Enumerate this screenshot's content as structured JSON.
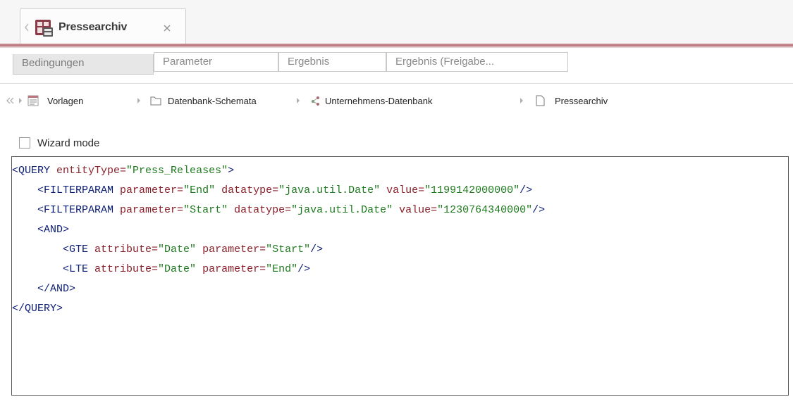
{
  "document_tab": {
    "title": "Pressearchiv",
    "close_icon": "close-icon",
    "app_icon": "database-schema-icon"
  },
  "subtabs": [
    {
      "label": "Bedingungen",
      "active": true
    },
    {
      "label": "Parameter",
      "active": false
    },
    {
      "label": "Ergebnis",
      "active": false
    },
    {
      "label": "Ergebnis (Freigabe...",
      "active": false
    }
  ],
  "breadcrumb": {
    "back_icon": "double-chevron-left-icon",
    "items": [
      {
        "label": "Vorlagen",
        "icon": "template-list-icon"
      },
      {
        "label": "Datenbank-Schemata",
        "icon": "folder-icon"
      },
      {
        "label": "Unternehmens-Datenbank",
        "icon": "database-connection-icon"
      },
      {
        "label": "Pressearchiv",
        "icon": "document-icon"
      }
    ]
  },
  "wizard": {
    "label": "Wizard mode",
    "checked": false
  },
  "editor": {
    "lines": [
      {
        "indent": "",
        "parts": [
          {
            "t": "<QUERY ",
            "c": "tag"
          },
          {
            "t": "entityType=",
            "c": "att"
          },
          {
            "t": "\"Press_Releases\"",
            "c": "str"
          },
          {
            "t": ">",
            "c": "tag"
          }
        ]
      },
      {
        "indent": "    ",
        "parts": [
          {
            "t": "<FILTERPARAM ",
            "c": "tag"
          },
          {
            "t": "parameter=",
            "c": "att"
          },
          {
            "t": "\"End\" ",
            "c": "str"
          },
          {
            "t": "datatype=",
            "c": "att"
          },
          {
            "t": "\"java.util.Date\" ",
            "c": "str"
          },
          {
            "t": "value=",
            "c": "att"
          },
          {
            "t": "\"1199142000000\"",
            "c": "str"
          },
          {
            "t": "/>",
            "c": "tag"
          }
        ]
      },
      {
        "indent": "    ",
        "parts": [
          {
            "t": "<FILTERPARAM ",
            "c": "tag"
          },
          {
            "t": "parameter=",
            "c": "att"
          },
          {
            "t": "\"Start\" ",
            "c": "str"
          },
          {
            "t": "datatype=",
            "c": "att"
          },
          {
            "t": "\"java.util.Date\" ",
            "c": "str"
          },
          {
            "t": "value=",
            "c": "att"
          },
          {
            "t": "\"1230764340000\"",
            "c": "str"
          },
          {
            "t": "/>",
            "c": "tag"
          }
        ]
      },
      {
        "indent": "    ",
        "parts": [
          {
            "t": "<AND>",
            "c": "tag"
          }
        ]
      },
      {
        "indent": "        ",
        "parts": [
          {
            "t": "<GTE ",
            "c": "tag"
          },
          {
            "t": "attribute=",
            "c": "att"
          },
          {
            "t": "\"Date\" ",
            "c": "str"
          },
          {
            "t": "parameter=",
            "c": "att"
          },
          {
            "t": "\"Start\"",
            "c": "str"
          },
          {
            "t": "/>",
            "c": "tag"
          }
        ]
      },
      {
        "indent": "        ",
        "parts": [
          {
            "t": "<LTE ",
            "c": "tag"
          },
          {
            "t": "attribute=",
            "c": "att"
          },
          {
            "t": "\"Date\" ",
            "c": "str"
          },
          {
            "t": "parameter=",
            "c": "att"
          },
          {
            "t": "\"End\"",
            "c": "str"
          },
          {
            "t": "/>",
            "c": "tag"
          }
        ]
      },
      {
        "indent": "    ",
        "parts": [
          {
            "t": "</AND>",
            "c": "tag"
          }
        ]
      },
      {
        "indent": "",
        "parts": [
          {
            "t": "</QUERY>",
            "c": "tag"
          }
        ]
      }
    ]
  },
  "colors": {
    "accent": "#b8757b",
    "tag": "#0b1c73",
    "attribute": "#8a1f2a",
    "string": "#1e7a1e"
  }
}
